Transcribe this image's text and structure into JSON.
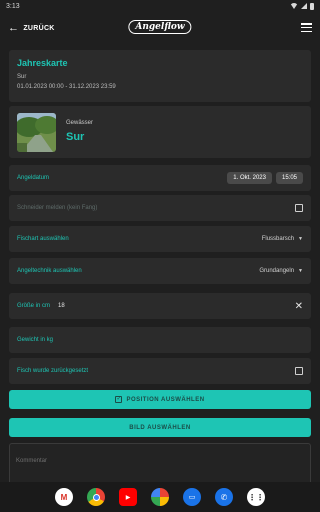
{
  "status_bar": {
    "time": "3:13"
  },
  "app_bar": {
    "back_label": "ZURÜCK",
    "logo_text": "Angelflow"
  },
  "ticket": {
    "title": "Jahreskarte",
    "subtitle": "Sur",
    "date_range": "01.01.2023 00:00 - 31.12.2023 23:59"
  },
  "water": {
    "label": "Gewässer",
    "name": "Sur"
  },
  "fields": {
    "date_label": "Angeldatum",
    "date_value": "1. Okt. 2023",
    "time_value": "15:05",
    "schneider_label": "Schneider melden (kein Fang)",
    "fish_label": "Fischart auswählen",
    "fish_value": "Flussbarsch",
    "technique_label": "Angeltechnik auswählen",
    "technique_value": "Grundangeln",
    "size_label": "Größe in cm",
    "size_value": "18",
    "weight_label": "Gewicht in kg",
    "released_label": "Fisch wurde zurückgesetzt"
  },
  "buttons": {
    "position_label": "POSITION AUSWÄHLEN",
    "image_label": "BILD AUSWÄHLEN"
  },
  "comment": {
    "placeholder": "Kommentar"
  },
  "nav_apps": [
    "gmail-icon",
    "chrome-icon",
    "youtube-icon",
    "photos-icon",
    "messages-icon",
    "phone-icon",
    "apps-icon"
  ],
  "colors": {
    "accent": "#1ec5b4",
    "background": "#1f1f1f",
    "card": "#2b2b2b"
  }
}
